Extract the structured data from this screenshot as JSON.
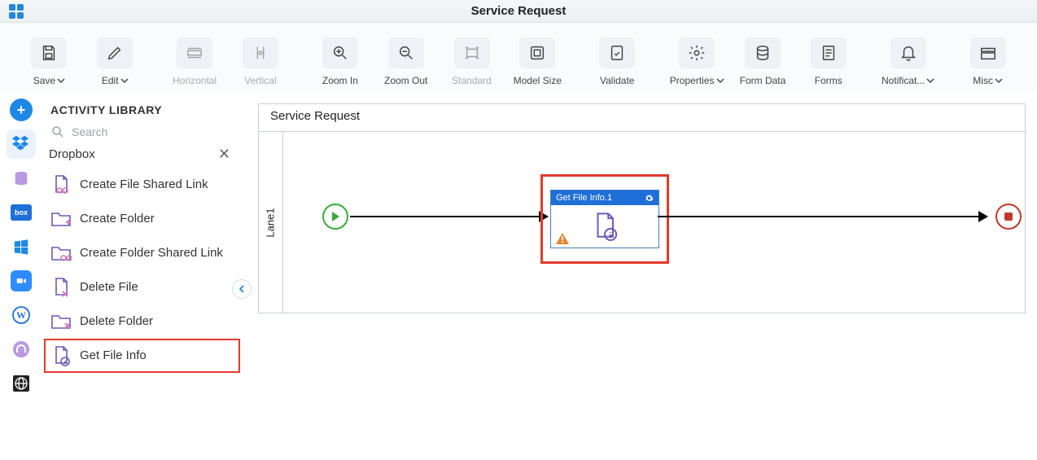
{
  "titlebar": {
    "title": "Service Request"
  },
  "toolbar": {
    "save": "Save",
    "edit": "Edit",
    "horizontal": "Horizontal",
    "vertical": "Vertical",
    "zoom_in": "Zoom In",
    "zoom_out": "Zoom Out",
    "standard": "Standard",
    "model_size": "Model Size",
    "validate": "Validate",
    "properties": "Properties",
    "form_data": "Form Data",
    "forms": "Forms",
    "notifications": "Notificat...",
    "misc": "Misc"
  },
  "library": {
    "header": "ACTIVITY LIBRARY",
    "search_placeholder": "Search",
    "group": "Dropbox",
    "items": [
      {
        "label": "Create File Shared Link"
      },
      {
        "label": "Create Folder"
      },
      {
        "label": "Create Folder Shared Link"
      },
      {
        "label": "Delete File"
      },
      {
        "label": "Delete Folder"
      },
      {
        "label": "Get File Info"
      }
    ]
  },
  "canvas": {
    "title": "Service Request",
    "lane_label": "Lane1",
    "node_title": "Get File Info.1"
  }
}
